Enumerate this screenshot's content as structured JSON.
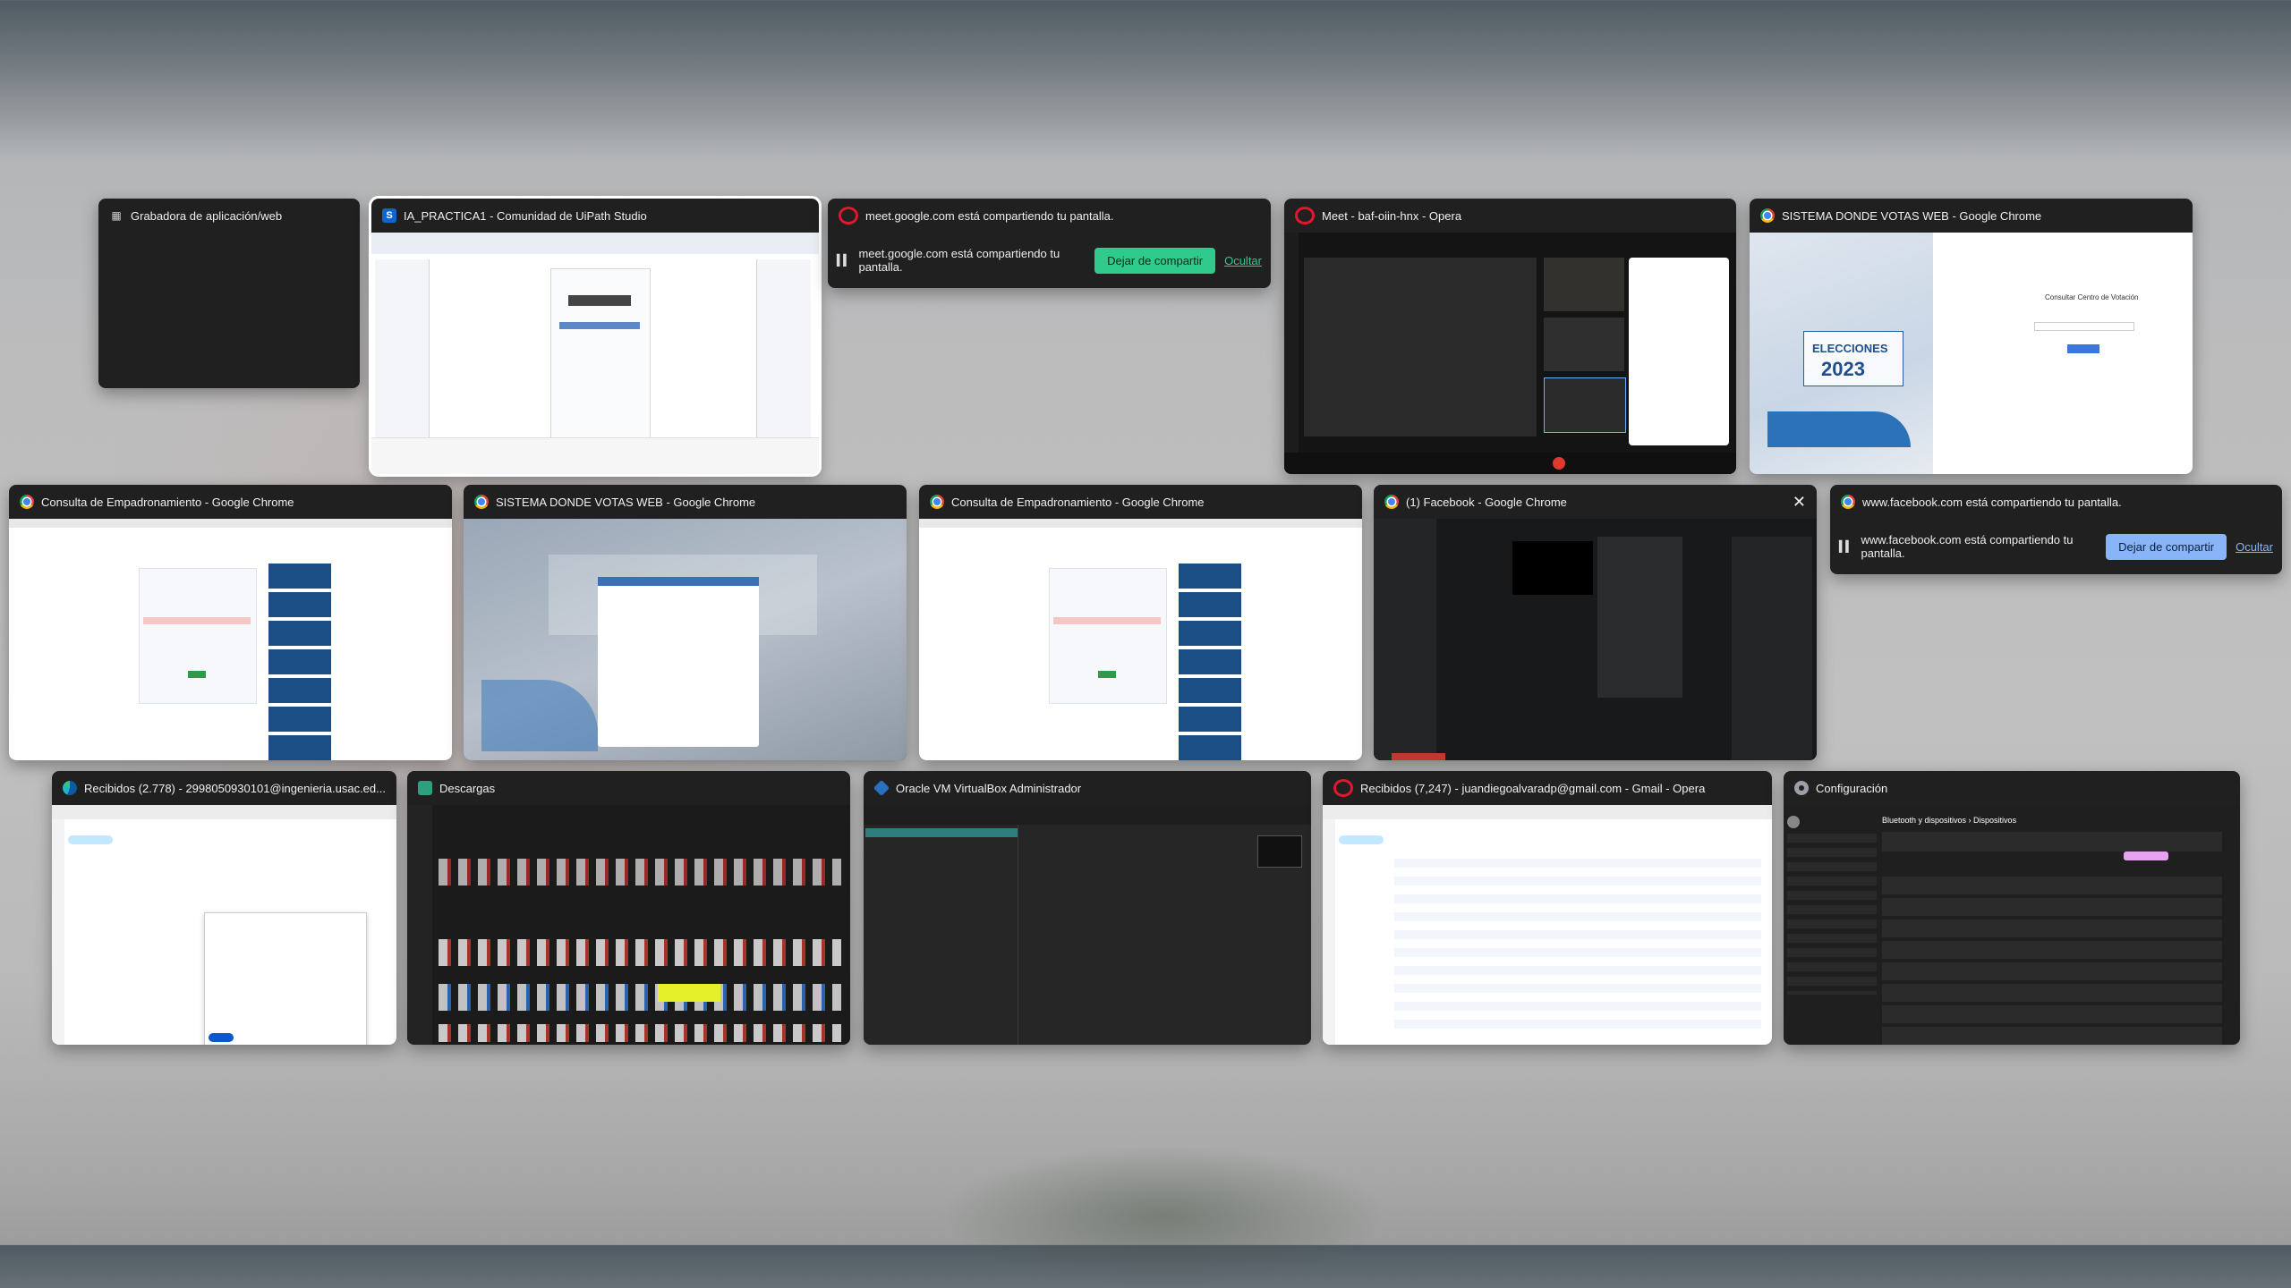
{
  "windows": [
    {
      "title": "Grabadora de aplicación/web",
      "icon": "recorder-icon"
    },
    {
      "title": "IA_PRACTICA1 - Comunidad de UiPath Studio",
      "icon": "uipath-icon"
    },
    {
      "title": "meet.google.com está compartiendo tu pantalla.",
      "icon": "opera-icon",
      "share_text": "meet.google.com está compartiendo tu pantalla.",
      "stop_label": "Dejar de compartir",
      "hide_label": "Ocultar"
    },
    {
      "title": "Meet - baf-oiin-hnx - Opera",
      "icon": "opera-icon"
    },
    {
      "title": "SISTEMA DONDE VOTAS WEB - Google Chrome",
      "icon": "chrome-icon",
      "banner_word": "ELECCIONES",
      "banner_year": "2023",
      "panel_title": "Consultar Centro de Votación"
    },
    {
      "title": "Consulta de Empadronamiento - Google Chrome",
      "icon": "chrome-icon"
    },
    {
      "title": "SISTEMA DONDE VOTAS WEB - Google Chrome",
      "icon": "chrome-icon"
    },
    {
      "title": "Consulta de Empadronamiento - Google Chrome",
      "icon": "chrome-icon"
    },
    {
      "title": "(1) Facebook - Google Chrome",
      "icon": "chrome-icon"
    },
    {
      "title": "www.facebook.com está compartiendo tu pantalla.",
      "icon": "chrome-icon",
      "share_text": "www.facebook.com está compartiendo tu pantalla.",
      "stop_label": "Dejar de compartir",
      "hide_label": "Ocultar"
    },
    {
      "title": "Recibidos (2.778) - 2998050930101@ingenieria.usac.ed...",
      "icon": "edge-icon"
    },
    {
      "title": "Descargas",
      "icon": "folder-icon"
    },
    {
      "title": "Oracle VM VirtualBox Administrador",
      "icon": "virtualbox-icon"
    },
    {
      "title": "Recibidos (7,247) - juandiegoalvaradp@gmail.com - Gmail - Opera",
      "icon": "opera-icon"
    },
    {
      "title": "Configuración",
      "icon": "gear-icon",
      "breadcrumb": "Bluetooth y dispositivos  ›  Dispositivos"
    }
  ],
  "colors": {
    "accent_green": "#2fca8c",
    "accent_blue": "#8ab4f8",
    "tile_bg": "#202020"
  }
}
